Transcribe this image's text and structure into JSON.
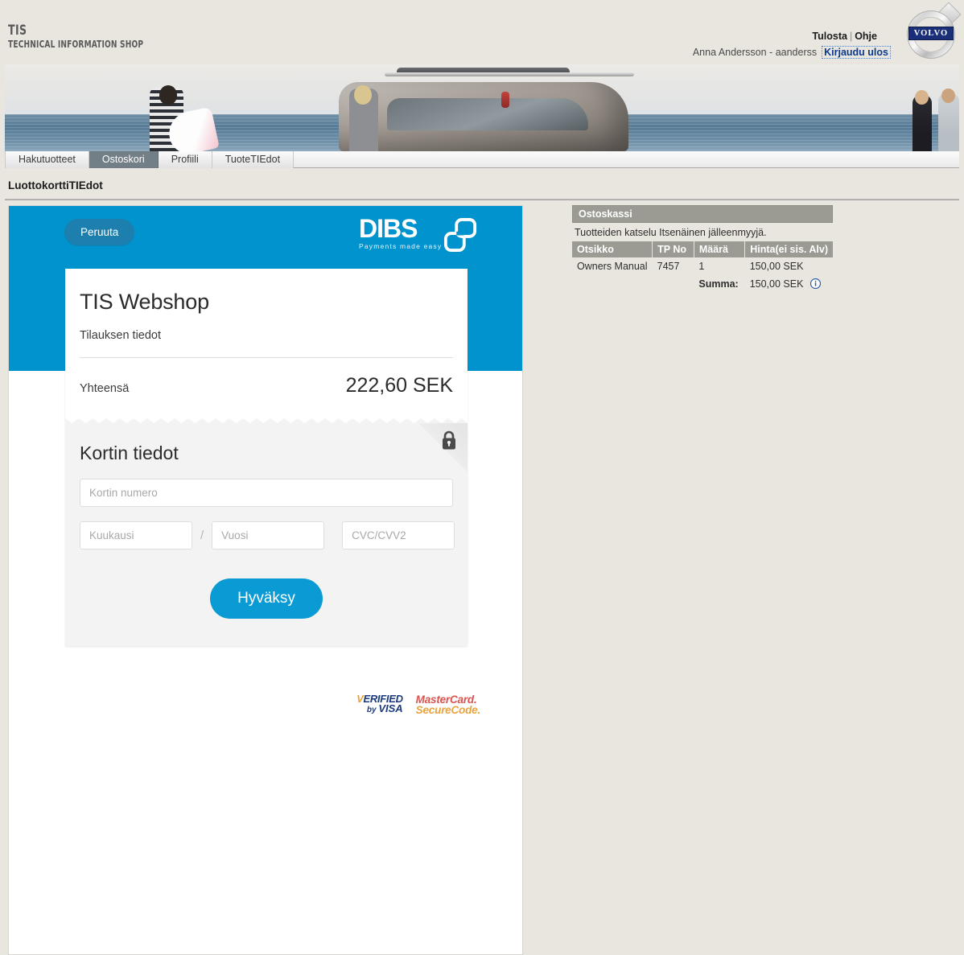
{
  "header": {
    "brand_tis": "TIS",
    "brand_subtitle": "TECHNICAL INFORMATION SHOP",
    "print_label": "Tulosta",
    "separator": "|",
    "help_label": "Ohje",
    "user_text": "Anna Andersson - aanderss",
    "logout_label": "Kirjaudu ulos",
    "volvo_wordmark": "VOLVO"
  },
  "tabs": [
    {
      "label": "Hakutuotteet",
      "active": false
    },
    {
      "label": "Ostoskori",
      "active": true
    },
    {
      "label": "Profiili",
      "active": false
    },
    {
      "label": "TuoteTIEdot",
      "active": false
    }
  ],
  "page": {
    "title": "LuottokorttiTIEdot"
  },
  "dibs": {
    "cancel_label": "Peruuta",
    "logo_word": "DIBS",
    "logo_tagline": "Payments made easy",
    "shop_title": "TIS Webshop",
    "order_subtitle": "Tilauksen tiedot",
    "total_label": "Yhteensä",
    "total_value": "222,60 SEK",
    "card_heading": "Kortin tiedot",
    "card_number_value": "",
    "card_number_placeholder": "Kortin numero",
    "month_value": "",
    "month_placeholder": "Kuukausi",
    "slash": "/",
    "year_value": "",
    "year_placeholder": "Vuosi",
    "cvc_value": "",
    "cvc_placeholder": "CVC/CVV2",
    "approve_label": "Hyväksy",
    "badges": {
      "visa_line1": "ERIFIED",
      "visa_by": "by ",
      "visa_visa": "VISA",
      "mc_line1": "MasterCard.",
      "mc_line2": "SecureCode."
    }
  },
  "cart": {
    "header": "Ostoskassi",
    "note": "Tuotteiden katselu Itsenäinen jälleenmyyjä.",
    "columns": [
      "Otsikko",
      "TP No",
      "Määrä",
      "Hinta(ei sis. Alv)"
    ],
    "rows": [
      {
        "title": "Owners Manual",
        "tp_no": "7457",
        "qty": "1",
        "price": "150,00 SEK"
      }
    ],
    "sum_label": "Summa:",
    "sum_value": "150,00 SEK",
    "info_icon": "info-icon"
  },
  "colors": {
    "dibs_blue": "#0093cd",
    "approve_blue": "#0b9bd4",
    "cancel_blue": "#1c7fae",
    "tab_active": "#737f87",
    "cart_header": "#9b9b93",
    "page_bg": "#e8e6df"
  }
}
